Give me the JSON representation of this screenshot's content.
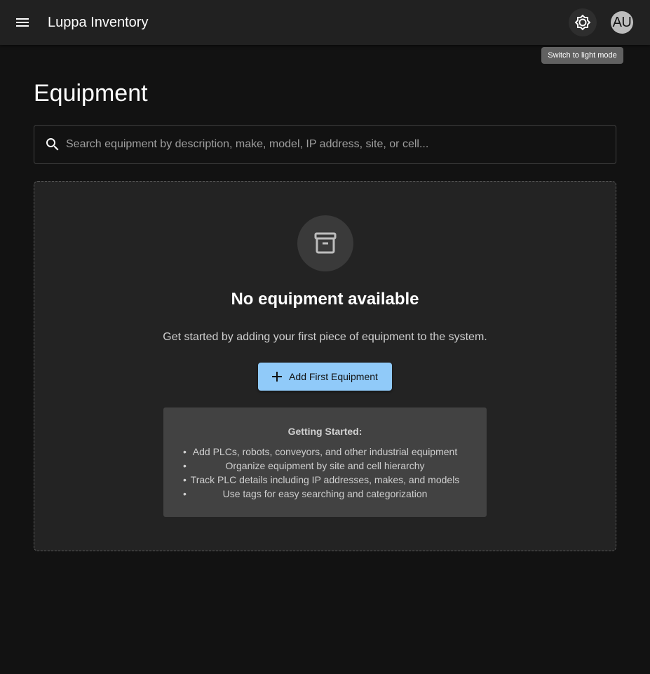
{
  "appbar": {
    "title": "Luppa Inventory",
    "avatar_initials": "AU",
    "theme_tooltip": "Switch to light mode"
  },
  "page": {
    "title": "Equipment"
  },
  "search": {
    "placeholder": "Search equipment by description, make, model, IP address, site, or cell...",
    "value": ""
  },
  "empty_state": {
    "title": "No equipment available",
    "description": "Get started by adding your first piece of equipment to the system.",
    "button_label": "Add First Equipment",
    "icon": "archive-icon"
  },
  "getting_started": {
    "title": "Getting Started:",
    "items": [
      "Add PLCs, robots, conveyors, and other industrial equipment",
      "Organize equipment by site and cell hierarchy",
      "Track PLC details including IP addresses, makes, and models",
      "Use tags for easy searching and categorization"
    ]
  },
  "colors": {
    "background": "#121212",
    "appbar": "#212121",
    "primary_button": "#90caf9",
    "card": "#232323",
    "info_box": "#424242"
  }
}
